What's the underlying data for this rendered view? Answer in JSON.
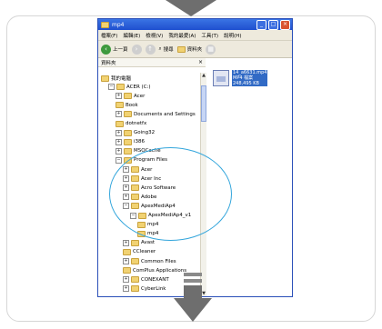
{
  "window": {
    "title": "mp4",
    "minimize": "_",
    "maximize": "□",
    "close": "×"
  },
  "menu": [
    "檔案(F)",
    "編輯(E)",
    "檢視(V)",
    "我的最愛(A)",
    "工具(T)",
    "說明(H)"
  ],
  "toolbar": {
    "back": "上一頁",
    "search": "搜尋",
    "folders": "資料夾"
  },
  "pane": {
    "title": "資料夾",
    "close": "×"
  },
  "tree": [
    {
      "label": "我的電腦",
      "indent": 0,
      "toggle": ""
    },
    {
      "label": "ACER (C:)",
      "indent": 1,
      "toggle": "−"
    },
    {
      "label": "Acer",
      "indent": 2,
      "toggle": "+"
    },
    {
      "label": "Book",
      "indent": 2,
      "toggle": ""
    },
    {
      "label": "Documents and Settings",
      "indent": 2,
      "toggle": "+"
    },
    {
      "label": "dotnetfx",
      "indent": 2,
      "toggle": ""
    },
    {
      "label": "Going32",
      "indent": 2,
      "toggle": "+"
    },
    {
      "label": "i386",
      "indent": 2,
      "toggle": "+"
    },
    {
      "label": "MSOCache",
      "indent": 2,
      "toggle": "+"
    },
    {
      "label": "Program Files",
      "indent": 2,
      "toggle": "−"
    },
    {
      "label": "Acer",
      "indent": 3,
      "toggle": "+"
    },
    {
      "label": "Acer Inc",
      "indent": 3,
      "toggle": "+"
    },
    {
      "label": "Acro Software",
      "indent": 3,
      "toggle": "+"
    },
    {
      "label": "Adobe",
      "indent": 3,
      "toggle": "+"
    },
    {
      "label": "ApexMediAp4",
      "indent": 3,
      "toggle": "−"
    },
    {
      "label": "ApexMediAp4_v1",
      "indent": 4,
      "toggle": "−"
    },
    {
      "label": "mp4",
      "indent": 5,
      "toggle": ""
    },
    {
      "label": "mp4",
      "indent": 5,
      "toggle": ""
    },
    {
      "label": "Avast",
      "indent": 3,
      "toggle": "+"
    },
    {
      "label": "CCleaner",
      "indent": 3,
      "toggle": ""
    },
    {
      "label": "Common Files",
      "indent": 3,
      "toggle": "+"
    },
    {
      "label": "ComPlus Applications",
      "indent": 3,
      "toggle": ""
    },
    {
      "label": "CONEXANT",
      "indent": 3,
      "toggle": "+"
    },
    {
      "label": "CyberLink",
      "indent": 3,
      "toggle": "+"
    }
  ],
  "file": {
    "name": "14_a6631.mp4",
    "type": "MP4 檔案",
    "size": "248,495 KB"
  }
}
